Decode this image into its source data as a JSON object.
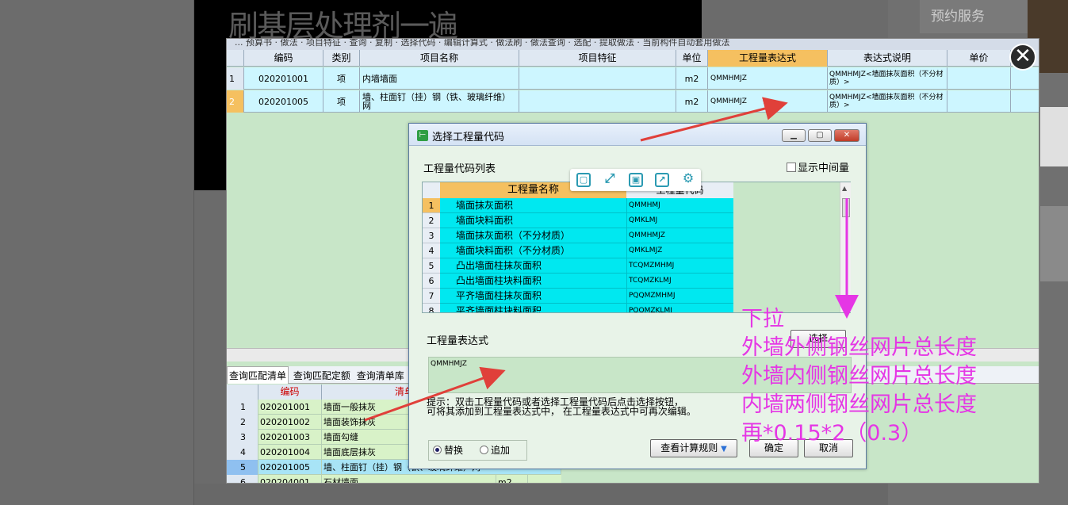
{
  "video": {
    "title": "刷基层处理剂一遍"
  },
  "right_panel": {
    "service_label": "预约服务"
  },
  "toolbar": {
    "text": "... 预算书 · 做法 · 项目特征 · 查询 · 复制 · 选择代码 · 编辑计算式 · 做法刷 · 做法查询 · 选配 · 提取做法 · 当前构件自动套用做法"
  },
  "main_grid": {
    "headers": [
      "编码",
      "类别",
      "项目名称",
      "项目特征",
      "单位",
      "工程量表达式",
      "表达式说明",
      "单价"
    ],
    "rows": [
      {
        "num": "1",
        "code": "020201001",
        "type": "项",
        "name": "内墙墙面",
        "feature": "",
        "unit": "m2",
        "expr": "QMMHMJZ",
        "desc": "QMMHMJZ<墙面抹灰面积（不分材质）>",
        "price": ""
      },
      {
        "num": "2",
        "code": "020201005",
        "type": "项",
        "name": "墙、柱面钉（挂）钢（铁、玻璃纤维）网",
        "feature": "",
        "unit": "m2",
        "expr": "QMMHMJZ",
        "desc": "QMMHMJZ<墙面抹灰面积（不分材质）>",
        "price": ""
      }
    ]
  },
  "bottom_tabs": [
    "查询匹配清单",
    "查询匹配定额",
    "查询清单库"
  ],
  "lower_grid": {
    "headers": [
      "编码",
      "清单"
    ],
    "rows": [
      {
        "num": "1",
        "code": "020201001",
        "name": "墙面一般抹灰"
      },
      {
        "num": "2",
        "code": "020201002",
        "name": "墙面装饰抹灰"
      },
      {
        "num": "3",
        "code": "020201003",
        "name": "墙面勾缝"
      },
      {
        "num": "4",
        "code": "020201004",
        "name": "墙面底层抹灰"
      },
      {
        "num": "5",
        "code": "020201005",
        "name": "墙、柱面钉（挂）钢（铁、玻璃纤维）网"
      },
      {
        "num": "6",
        "code": "020204001",
        "name": "石材墙面"
      }
    ],
    "unit_partial": "m2"
  },
  "dialog": {
    "title": "选择工程量代码",
    "list_label": "工程量代码列表",
    "show_intermediate": "显示中间量",
    "col_name": "工程量名称",
    "col_code": "工程量代码",
    "codes": [
      {
        "num": "1",
        "name": "墙面抹灰面积",
        "code": "QMMHMJ"
      },
      {
        "num": "2",
        "name": "墙面块料面积",
        "code": "QMKLMJ"
      },
      {
        "num": "3",
        "name": "墙面抹灰面积（不分材质）",
        "code": "QMMHMJZ"
      },
      {
        "num": "4",
        "name": "墙面块料面积（不分材质）",
        "code": "QMKLMJZ"
      },
      {
        "num": "5",
        "name": "凸出墙面柱抹灰面积",
        "code": "TCQMZMHMJ"
      },
      {
        "num": "6",
        "name": "凸出墙面柱块料面积",
        "code": "TCQMZKLMJ"
      },
      {
        "num": "7",
        "name": "平齐墙面柱抹灰面积",
        "code": "PQQMZMHMJ"
      },
      {
        "num": "8",
        "name": "平齐墙面柱块料面积",
        "code": "PQQMZKLMJ"
      }
    ],
    "expr_label": "工程量表达式",
    "select_button": "选择",
    "expr_value": "QMMHMJZ",
    "hint_line1": "提示：双击工程量代码或者选择工程量代码后点击选择按钮，",
    "hint_line2": "可将其添加到工程量表达式中， 在工程量表达式中可再次编辑。",
    "radio_replace": "替换",
    "radio_append": "追加",
    "view_rules": "查看计算规则",
    "ok": "确定",
    "cancel": "取消"
  },
  "annotation": {
    "lines": [
      "下拉",
      "外墙外侧钢丝网片总长度",
      "外墙内侧钢丝网片总长度",
      "内墙两侧钢丝网片总长度",
      "再*0.15*2（0.3）"
    ],
    "color": "#e536e5"
  },
  "colors": {
    "highlight_header": "#f5c060",
    "cyan_row": "#00e8f0",
    "grid_bg": "#c8e6c8",
    "arrow_red": "#e0403a"
  }
}
